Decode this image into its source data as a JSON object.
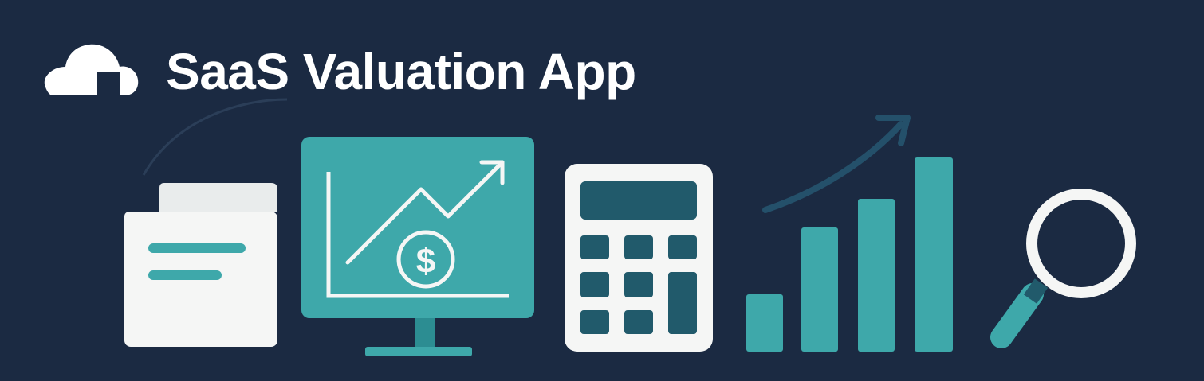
{
  "header": {
    "title": "SaaS Valuation App",
    "logo_icon": "cloud-icon"
  },
  "illustrations": [
    {
      "name": "document-icon"
    },
    {
      "name": "monitor-growth-chart-icon",
      "symbol": "$"
    },
    {
      "name": "calculator-icon"
    },
    {
      "name": "bar-chart-growth-icon"
    },
    {
      "name": "magnifying-glass-icon"
    }
  ],
  "colors": {
    "background": "#1b2a42",
    "accent_teal": "#3ea8aa",
    "dark_teal": "#215a6b",
    "white": "#f5f6f5"
  }
}
